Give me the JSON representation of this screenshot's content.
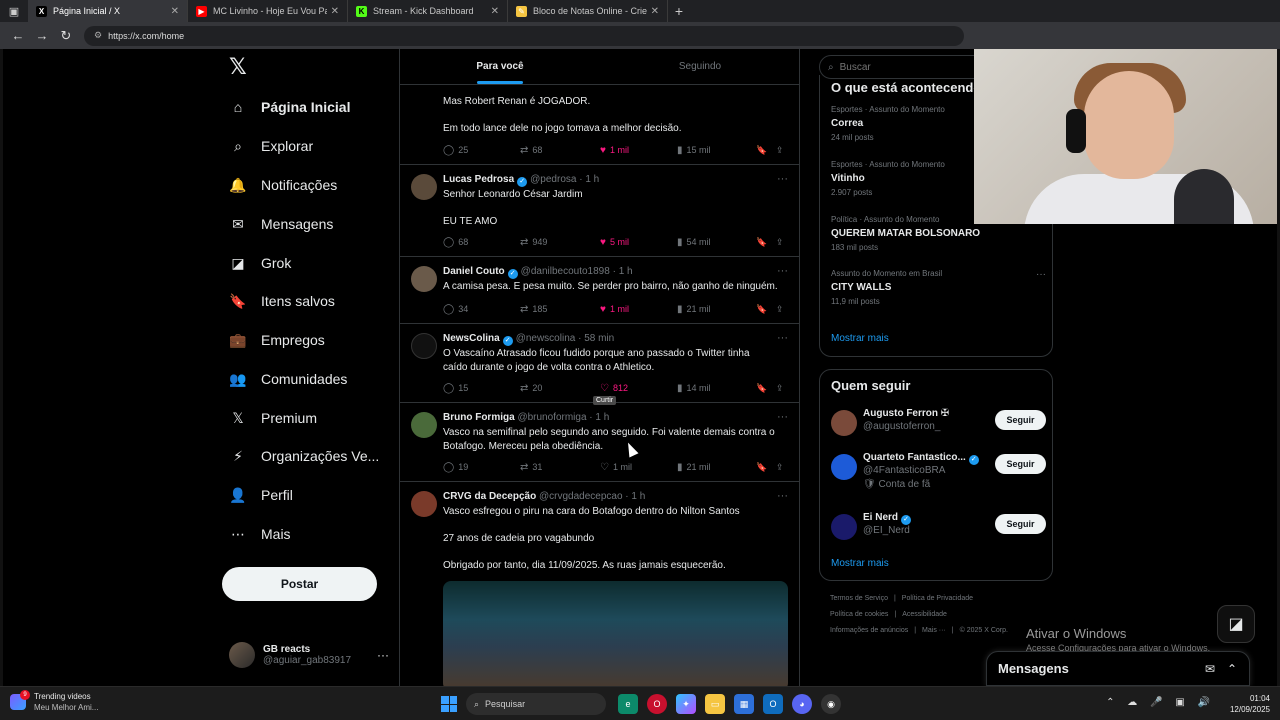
{
  "browser": {
    "tabs": [
      {
        "label": "Página Inicial / X",
        "fav_color": "#000000",
        "fav_text": "X",
        "active": true
      },
      {
        "label": "MC Livinho - Hoje Eu Vou Parar na",
        "fav_color": "#ff0000",
        "fav_text": "▶",
        "active": false
      },
      {
        "label": "Stream - Kick Dashboard",
        "fav_color": "#53fc18",
        "fav_text": "K",
        "active": false
      },
      {
        "label": "Bloco de Notas Online - Crie e Co",
        "fav_color": "#f5c542",
        "fav_text": "✎",
        "active": false
      }
    ],
    "url": "https://x.com/home"
  },
  "nav": {
    "items": [
      {
        "label": "Página Inicial",
        "icon": "home-icon",
        "glyph": "⌂",
        "bold": true
      },
      {
        "label": "Explorar",
        "icon": "search-icon",
        "glyph": "⌕"
      },
      {
        "label": "Notificações",
        "icon": "bell-icon",
        "glyph": "🔔"
      },
      {
        "label": "Mensagens",
        "icon": "mail-icon",
        "glyph": "✉"
      },
      {
        "label": "Grok",
        "icon": "grok-icon",
        "glyph": "◪"
      },
      {
        "label": "Itens salvos",
        "icon": "bookmark-icon",
        "glyph": "🔖"
      },
      {
        "label": "Empregos",
        "icon": "briefcase-icon",
        "glyph": "💼"
      },
      {
        "label": "Comunidades",
        "icon": "communities-icon",
        "glyph": "👥"
      },
      {
        "label": "Premium",
        "icon": "x-premium-icon",
        "glyph": "𝕏"
      },
      {
        "label": "Organizações Ve...",
        "icon": "lightning-icon",
        "glyph": "⚡"
      },
      {
        "label": "Perfil",
        "icon": "person-icon",
        "glyph": "👤"
      },
      {
        "label": "Mais",
        "icon": "more-circle-icon",
        "glyph": "⋯"
      }
    ],
    "post_label": "Postar",
    "account": {
      "name": "GB reacts",
      "handle": "@aguiar_gab83917"
    }
  },
  "feed": {
    "tabs": [
      "Para você",
      "Seguindo"
    ],
    "posts": [
      {
        "name": "",
        "handle": "",
        "time": "",
        "verified": false,
        "lines": [
          "Mas Robert Renan é JOGADOR.",
          "",
          "Em todo lance dele no jogo tomava a melhor decisão."
        ],
        "replies": "25",
        "reposts": "68",
        "likes": "1 mil",
        "views": "15 mil",
        "liked": true
      },
      {
        "name": "Lucas Pedrosa",
        "handle": "@pedrosa",
        "time": "1 h",
        "verified": true,
        "lines": [
          "Senhor Leonardo César Jardim",
          "",
          "EU TE AMO"
        ],
        "replies": "68",
        "reposts": "949",
        "likes": "5 mil",
        "views": "54 mil",
        "liked": true
      },
      {
        "name": "Daniel Couto",
        "handle": "@danilbecouto1898",
        "time": "1 h",
        "verified": true,
        "lines": [
          "A camisa pesa. E pesa muito. Se perder pro bairro, não ganho de ninguém."
        ],
        "replies": "34",
        "reposts": "185",
        "likes": "1 mil",
        "views": "21 mil",
        "liked": true
      },
      {
        "name": "NewsColina",
        "handle": "@newscolina",
        "time": "58 min",
        "verified": true,
        "lines": [
          "O Vascaíno Atrasado ficou fudido porque ano passado o Twitter tinha",
          "caído durante o jogo de volta contra o Athletico."
        ],
        "replies": "15",
        "reposts": "20",
        "likes": "812",
        "views": "14 mil",
        "liked": false,
        "hover": true,
        "tooltip": "Curtir"
      },
      {
        "name": "Bruno Formiga",
        "handle": "@brunoformiga",
        "time": "1 h",
        "verified": false,
        "lines": [
          "Vasco na semifinal pelo segundo ano seguido. Foi valente demais contra o",
          "Botafogo. Mereceu pela obediência."
        ],
        "replies": "19",
        "reposts": "31",
        "likes": "1 mil",
        "views": "21 mil",
        "liked": false
      },
      {
        "name": "CRVG da Decepção",
        "handle": "@crvgdadecepcao",
        "time": "1 h",
        "verified": false,
        "lines": [
          "Vasco esfregou o piru na cara do Botafogo dentro do Nilton Santos",
          "",
          "27 anos de cadeia pro vagabundo",
          "",
          "Obrigado por tanto, dia 11/09/2025. As ruas jamais esquecerão."
        ],
        "has_media": true
      }
    ]
  },
  "right": {
    "search_placeholder": "Buscar",
    "trends_title": "O que está acontecendo",
    "trends": [
      {
        "category": "Esportes · Assunto do Momento",
        "title": "Correa",
        "posts": "24 mil posts"
      },
      {
        "category": "Esportes · Assunto do Momento",
        "title": "Vitinho",
        "posts": "2.907 posts"
      },
      {
        "category": "Política · Assunto do Momento",
        "title": "QUEREM MATAR BOLSONARO",
        "posts": "183 mil posts"
      },
      {
        "category": "Assunto do Momento em Brasil",
        "title": "CITY WALLS",
        "posts": "11,9 mil posts"
      }
    ],
    "show_more": "Mostrar mais",
    "who_title": "Quem seguir",
    "who": [
      {
        "name": "Augusto Ferron ✠",
        "handle": "@augustoferron_",
        "extra": "",
        "verified": false,
        "color": "#7a4a3a"
      },
      {
        "name": "Quarteto Fantastico...",
        "handle": "@4FantasticoBRA",
        "extra": "🛡 Conta de fã",
        "verified": true,
        "color": "#1d5bd8"
      },
      {
        "name": "Ei Nerd",
        "handle": "@EI_Nerd",
        "extra": "",
        "verified": true,
        "color": "#1a1a6a"
      }
    ],
    "follow_label": "Seguir",
    "footer1": [
      "Termos de Serviço",
      "Política de Privacidade"
    ],
    "footer2": [
      "Política de cookies",
      "Acessibilidade"
    ],
    "footer3": [
      "Informações de anúncios",
      "Mais ···",
      "© 2025 X Corp."
    ]
  },
  "overlay": {
    "watermark_title": "Ativar o Windows",
    "watermark_sub": "Acesse Configurações para ativar o Windows.",
    "messages_title": "Mensagens"
  },
  "taskbar": {
    "weather_title": "Trending videos",
    "weather_sub": "Meu Melhor Ami...",
    "badge": "9",
    "search_placeholder": "Pesquisar",
    "time": "01:04",
    "date": "12/09/2025"
  }
}
